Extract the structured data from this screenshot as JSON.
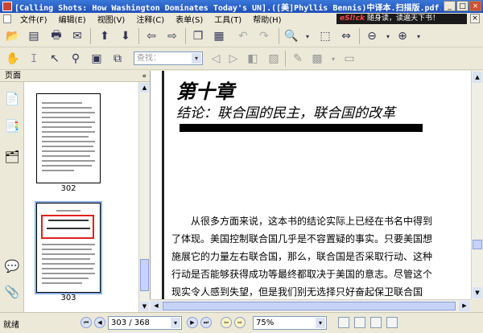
{
  "window": {
    "title": "[Calling Shots: How Washington Dominates Today's UN].([美]Phyllis Bennis)中译本.扫描版.pdf...",
    "minimize": "_",
    "maximize": "□",
    "close": "×"
  },
  "menu": {
    "items": [
      {
        "label": "文件(F)"
      },
      {
        "label": "编辑(E)"
      },
      {
        "label": "视图(V)"
      },
      {
        "label": "注释(C)"
      },
      {
        "label": "表单(S)"
      },
      {
        "label": "工具(T)"
      },
      {
        "label": "帮助(H)"
      }
    ],
    "promo_brand": "eSl!ck",
    "promo_text": "随身读，读遍天下书！",
    "close": "×"
  },
  "toolbar2": {
    "find_placeholder": "查找："
  },
  "left_panel": {
    "header": "页面",
    "collapse": "«",
    "thumbnails": [
      {
        "page": "302"
      },
      {
        "page": "303"
      }
    ]
  },
  "document": {
    "chapter_title": "第十章",
    "chapter_subtitle": "结论：联合国的民主，联合国的改革",
    "paragraph_lines": [
      "从很多方面来说，这本书的结论实际上已经在书名中得到",
      "了体现。美国控制联合国几乎是不容置疑的事实。只要美国想",
      "施展它的力量左右联合国，那么，联合国是否采取行动、这种",
      "行动是否能够获得成功等最终都取决于美国的意志。尽管这个",
      "现实令人感到失望，但是我们别无选择只好奋起保卫联合国"
    ]
  },
  "statusbar": {
    "status": "就绪",
    "page_indicator": "303 / 368",
    "zoom": "75%"
  }
}
